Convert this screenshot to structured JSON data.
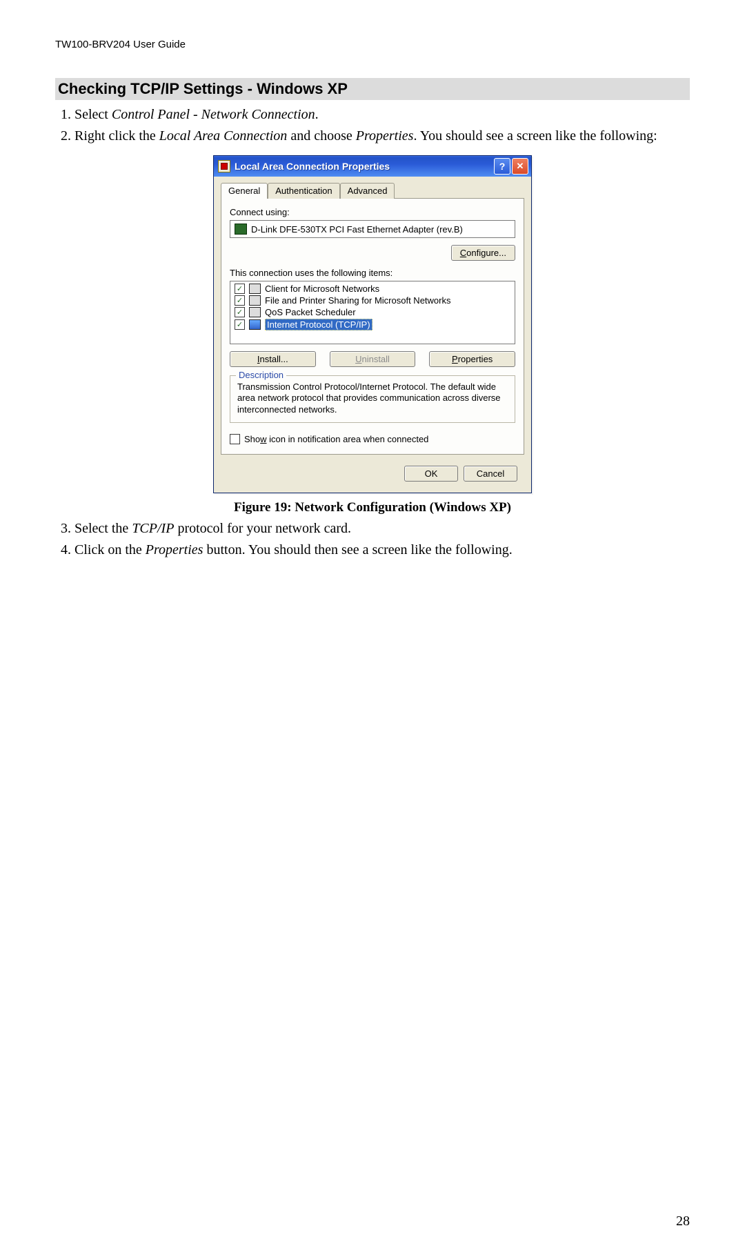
{
  "header": "TW100-BRV204 User Guide",
  "section_heading": "Checking TCP/IP Settings - Windows XP",
  "steps_a": {
    "s1_a": "Select ",
    "s1_i": "Control Panel - Network Connection",
    "s1_b": ".",
    "s2_a": "Right click the ",
    "s2_i1": "Local Area Connection",
    "s2_b": " and choose ",
    "s2_i2": "Properties",
    "s2_c": ". You should see a screen like the following:"
  },
  "figure_caption": "Figure 19: Network Configuration (Windows XP)",
  "steps_b": {
    "s3_a": "Select the ",
    "s3_i": "TCP/IP",
    "s3_b": " protocol for your network card.",
    "s4_a": "Click on the ",
    "s4_i": "Properties",
    "s4_b": " button. You should then see a screen like the following."
  },
  "page_number": "28",
  "dialog": {
    "title": "Local Area Connection Properties",
    "tabs": {
      "general": "General",
      "auth": "Authentication",
      "adv": "Advanced"
    },
    "connect_using_label": "Connect using:",
    "adapter": "D-Link DFE-530TX PCI Fast Ethernet Adapter (rev.B)",
    "configure_btn_u": "C",
    "configure_btn_rest": "onfigure...",
    "items_label": "This connection uses the following items:",
    "items": {
      "i0": "Client for Microsoft Networks",
      "i1": "File and Printer Sharing for Microsoft Networks",
      "i2": "QoS Packet Scheduler",
      "i3": "Internet Protocol (TCP/IP)"
    },
    "install_u": "I",
    "install_rest": "nstall...",
    "uninstall_u": "U",
    "uninstall_rest": "ninstall",
    "properties_u": "P",
    "properties_rest": "roperties",
    "description_legend": "Description",
    "description_text": "Transmission Control Protocol/Internet Protocol. The default wide area network protocol that provides communication across diverse interconnected networks.",
    "show_icon_u": "w",
    "show_icon_pre": "Sho",
    "show_icon_post": " icon in notification area when connected",
    "ok": "OK",
    "cancel": "Cancel"
  }
}
